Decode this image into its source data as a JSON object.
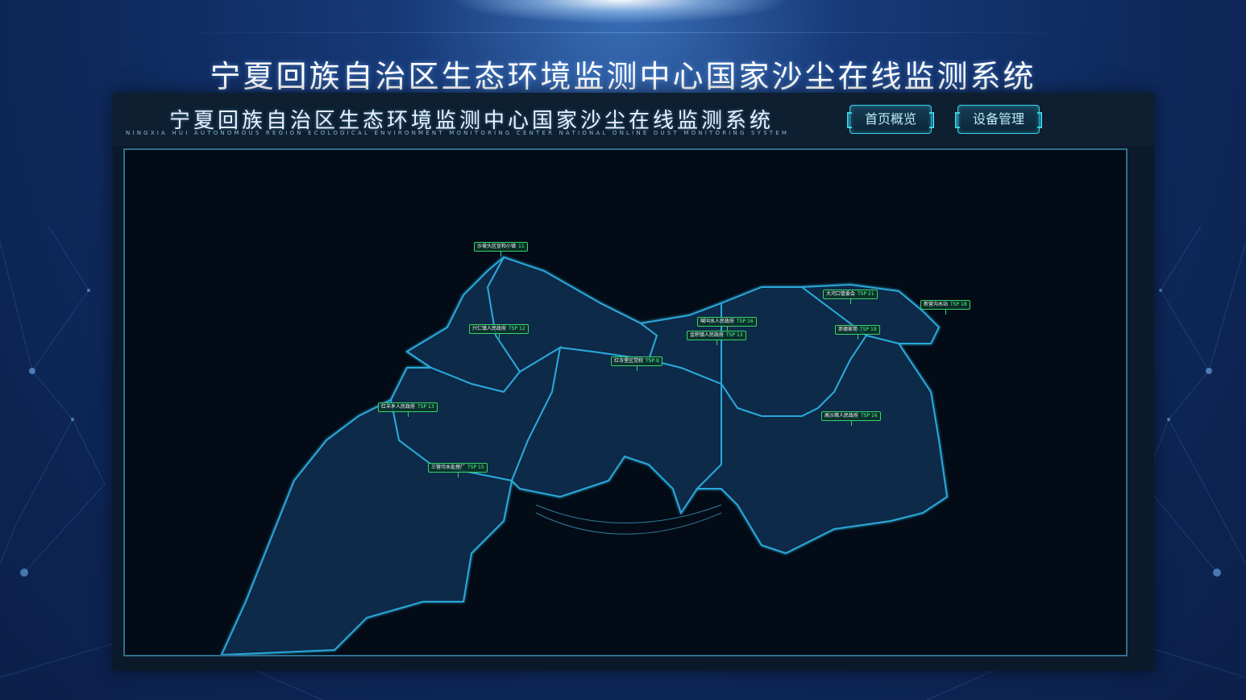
{
  "page": {
    "title": "宁夏回族自治区生态环境监测中心国家沙尘在线监测系统"
  },
  "app": {
    "title": "宁夏回族自治区生态环境监测中心国家沙尘在线监测系统",
    "subtitle": "NINGXIA HUI AUTONOMOUS REGION ECOLOGICAL ENVIRONMENT MONITORING CENTER NATIONAL ONLINE DUST MONITORING SYSTEM",
    "nav": {
      "home_label": "首页概览",
      "device_label": "设备管理"
    }
  },
  "map": {
    "markers": [
      {
        "label": "沙坡头区宣和小镇",
        "value": "11"
      },
      {
        "label": "兴仁镇人民政府",
        "value": "TSP 12"
      },
      {
        "label": "红寺堡区党校",
        "value": "TSP 9"
      },
      {
        "label": "喊叫水人民政府",
        "value": "TSP 16"
      },
      {
        "label": "金积镇人民政府",
        "value": "TSP 13"
      },
      {
        "label": "大河口管委会",
        "value": "TSP 21"
      },
      {
        "label": "新营沟水站",
        "value": "TSP 18"
      },
      {
        "label": "崇德家苑",
        "value": "TSP 19"
      },
      {
        "label": "红羊乡人民政府",
        "value": "TSP 13"
      },
      {
        "label": "高沙窝人民政府",
        "value": "TSP 16"
      },
      {
        "label": "三营污水处理厂",
        "value": "TSP 15"
      }
    ],
    "colors": {
      "region_fill": "#0e2a4a",
      "region_border": "#2aa8d8",
      "marker_border": "#3bd36a"
    }
  }
}
